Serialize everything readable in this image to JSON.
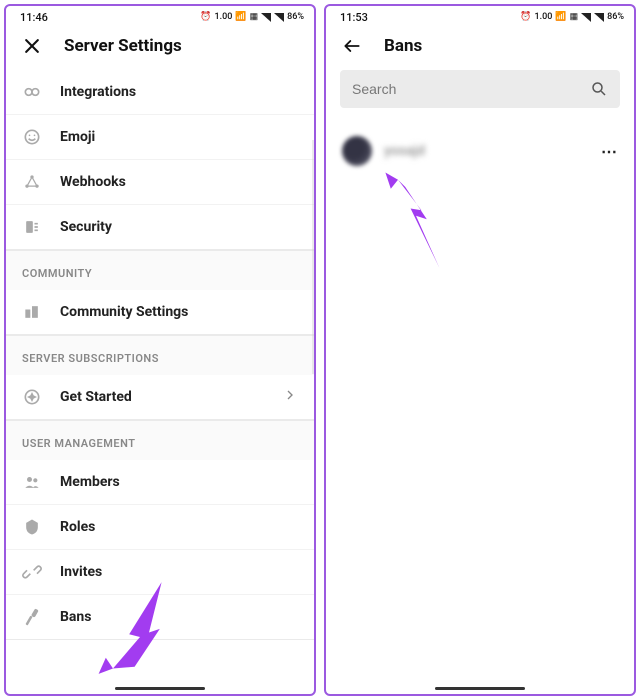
{
  "left": {
    "status": {
      "time": "11:46",
      "battery": "86%",
      "net": "1.00"
    },
    "header": {
      "title": "Server Settings"
    },
    "groups": [
      {
        "label": null,
        "items": [
          {
            "icon": "integrations",
            "label": "Integrations"
          },
          {
            "icon": "emoji",
            "label": "Emoji"
          },
          {
            "icon": "webhooks",
            "label": "Webhooks"
          },
          {
            "icon": "security",
            "label": "Security"
          }
        ]
      },
      {
        "label": "COMMUNITY",
        "items": [
          {
            "icon": "community",
            "label": "Community Settings"
          }
        ]
      },
      {
        "label": "SERVER SUBSCRIPTIONS",
        "items": [
          {
            "icon": "getstarted",
            "label": "Get Started",
            "chevron": true
          }
        ]
      },
      {
        "label": "USER MANAGEMENT",
        "items": [
          {
            "icon": "members",
            "label": "Members"
          },
          {
            "icon": "roles",
            "label": "Roles"
          },
          {
            "icon": "invites",
            "label": "Invites"
          },
          {
            "icon": "bans",
            "label": "Bans"
          }
        ]
      }
    ]
  },
  "right": {
    "status": {
      "time": "11:53",
      "battery": "86%",
      "net": "1.00"
    },
    "header": {
      "title": "Bans"
    },
    "search": {
      "placeholder": "Search"
    },
    "bans": [
      {
        "name": "yosajd"
      }
    ]
  }
}
